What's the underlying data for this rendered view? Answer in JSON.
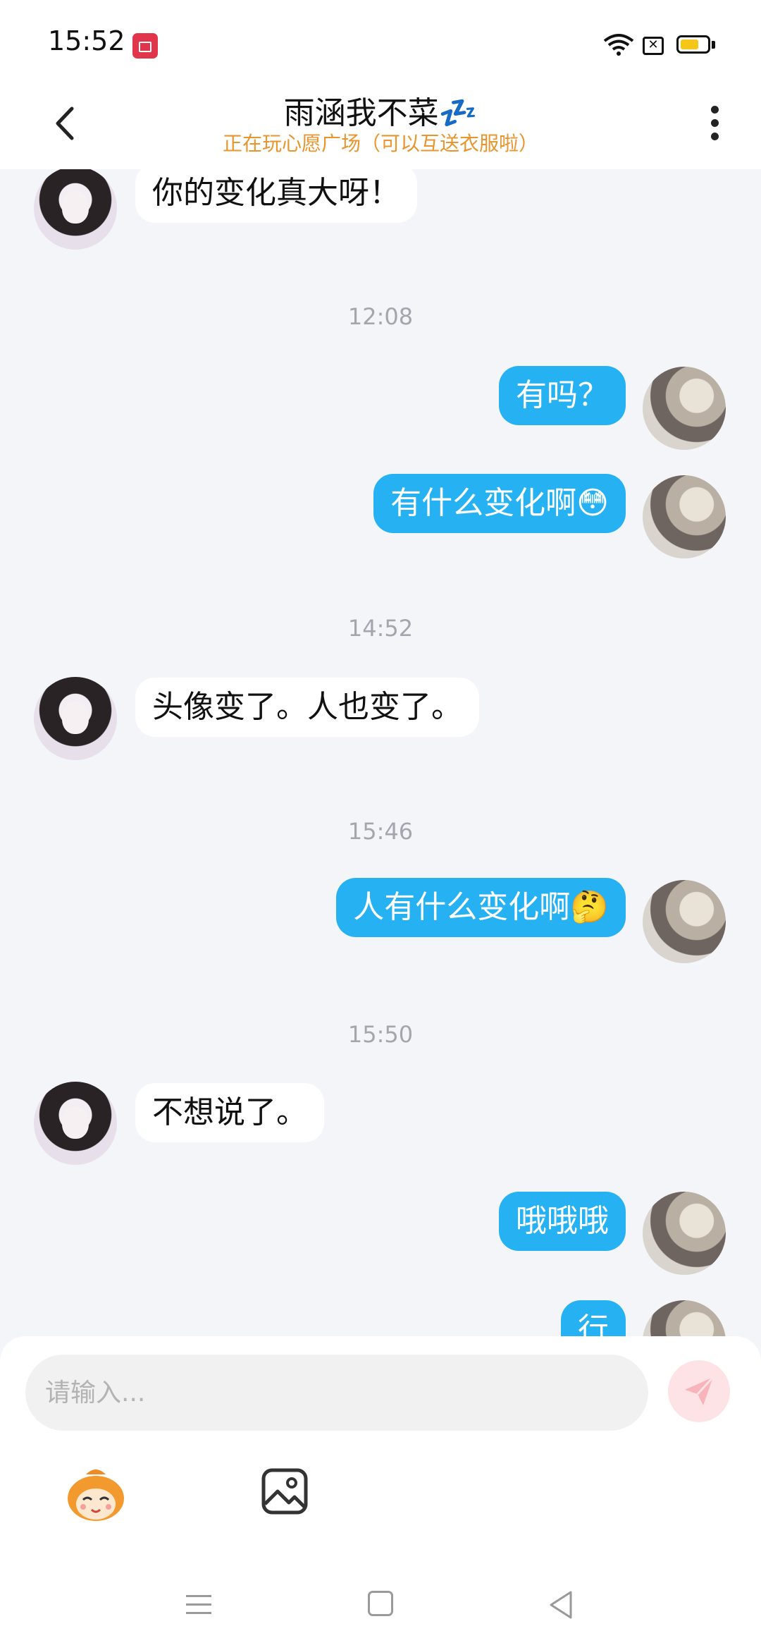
{
  "status_bar": {
    "time": "15:52",
    "battery_level": 0.7,
    "sim_label": "✕"
  },
  "header": {
    "title": "雨涵我不菜💤",
    "subtitle": "正在玩心愿广场（可以互送衣服啦）",
    "back_icon": "chevron-left-icon",
    "more_icon": "more-vertical-icon"
  },
  "messages": [
    {
      "type": "in",
      "text": "你的变化真大呀！"
    },
    {
      "type": "time",
      "text": "12:08"
    },
    {
      "type": "out",
      "text": "有吗？"
    },
    {
      "type": "out",
      "text": "有什么变化啊😳"
    },
    {
      "type": "time",
      "text": "14:52"
    },
    {
      "type": "in",
      "text": "头像变了。人也变了。"
    },
    {
      "type": "time",
      "text": "15:46"
    },
    {
      "type": "out",
      "text": "人有什么变化啊🤔"
    },
    {
      "type": "time",
      "text": "15:50"
    },
    {
      "type": "in",
      "text": "不想说了。"
    },
    {
      "type": "out",
      "text": "哦哦哦"
    },
    {
      "type": "out",
      "text": "行"
    }
  ],
  "input": {
    "placeholder": "请输入...",
    "value": ""
  },
  "colors": {
    "accent": "#26b2f2",
    "subtitle": "#e8952d",
    "background": "#f3f5f9"
  }
}
